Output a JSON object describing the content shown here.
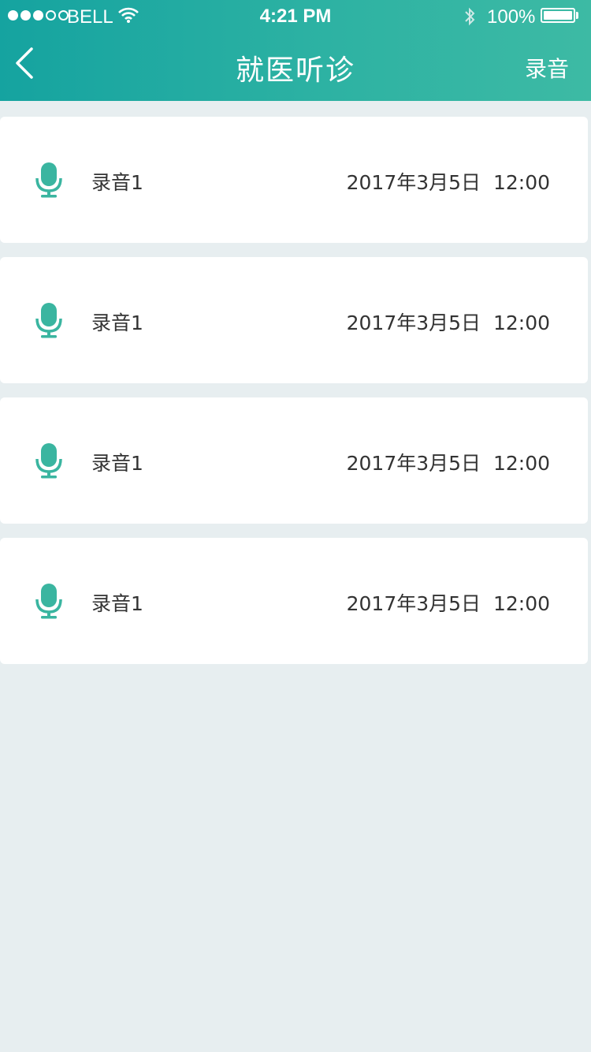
{
  "status_bar": {
    "carrier": "BELL",
    "time": "4:21 PM",
    "battery": "100%"
  },
  "nav": {
    "title": "就医听诊",
    "record_label": "录音"
  },
  "colors": {
    "accent": "#2db2a3",
    "icon": "#3ab5a0",
    "background": "#e7eef0"
  },
  "recordings": [
    {
      "title": "录音1",
      "date": "2017年3月5日",
      "time": "12:00"
    },
    {
      "title": "录音1",
      "date": "2017年3月5日",
      "time": "12:00"
    },
    {
      "title": "录音1",
      "date": "2017年3月5日",
      "time": "12:00"
    },
    {
      "title": "录音1",
      "date": "2017年3月5日",
      "time": "12:00"
    }
  ]
}
